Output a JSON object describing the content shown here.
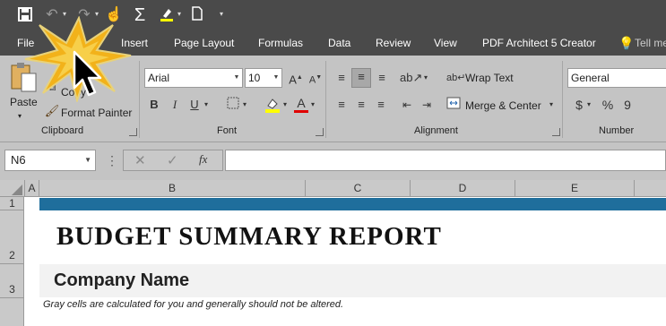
{
  "quick_access": {
    "icons": [
      "save-icon",
      "undo-icon",
      "redo-icon",
      "touch-mode-icon",
      "autosum-icon",
      "highlight-icon",
      "new-file-icon",
      "customize-icon"
    ]
  },
  "menu": {
    "file": "File",
    "tabs": [
      "Insert",
      "Page Layout",
      "Formulas",
      "Data",
      "Review",
      "View",
      "PDF Architect 5 Creator"
    ],
    "tell_me": "Tell me"
  },
  "ribbon": {
    "clipboard": {
      "paste": "Paste",
      "copy": "Copy",
      "format_painter": "Format Painter",
      "label": "Clipboard"
    },
    "font": {
      "font_name": "Arial",
      "font_size": "10",
      "bold": "B",
      "italic": "I",
      "underline": "U",
      "fill_color": "#ffff00",
      "font_color": "#e00000",
      "label": "Font"
    },
    "alignment": {
      "wrap_text": "Wrap Text",
      "merge_center": "Merge & Center",
      "label": "Alignment"
    },
    "number": {
      "format": "General",
      "currency": "$",
      "percent": "%",
      "comma": "9",
      "label": "Number"
    }
  },
  "formula_bar": {
    "name_box": "N6",
    "fx": "fx",
    "formula": ""
  },
  "grid": {
    "columns": [
      "A",
      "B",
      "C",
      "D",
      "E"
    ],
    "rows": [
      "1",
      "2",
      "3"
    ],
    "header_bar_color": "#1f6e9c"
  },
  "sheet": {
    "title": "BUDGET SUMMARY REPORT",
    "company": "Company Name",
    "note": "Gray cells are calculated for you and generally should not be altered."
  }
}
